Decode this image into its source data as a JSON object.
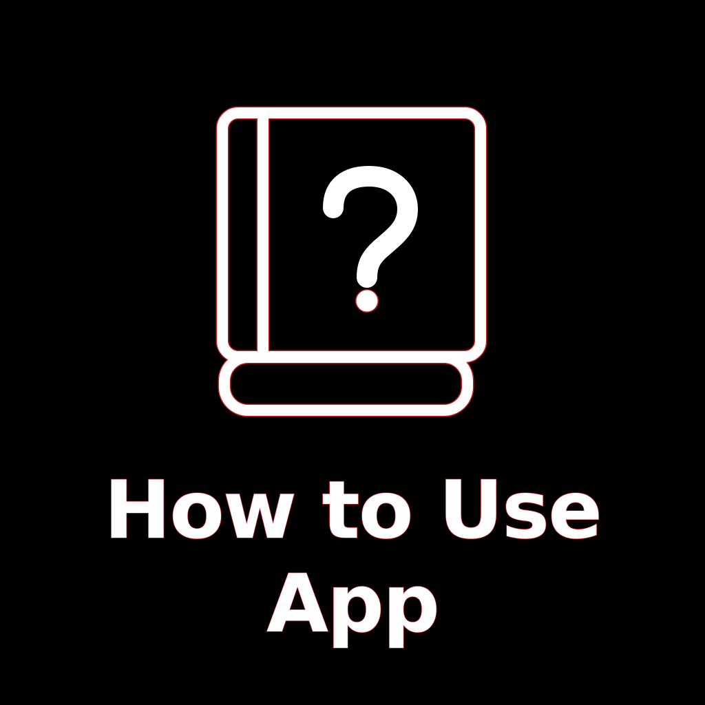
{
  "tile": {
    "icon": "book-question-icon",
    "label_line_1": "How to Use",
    "label_line_2": "App"
  },
  "colors": {
    "background": "#000000",
    "foreground": "#ffffff",
    "outline": "#cc1a1a"
  }
}
